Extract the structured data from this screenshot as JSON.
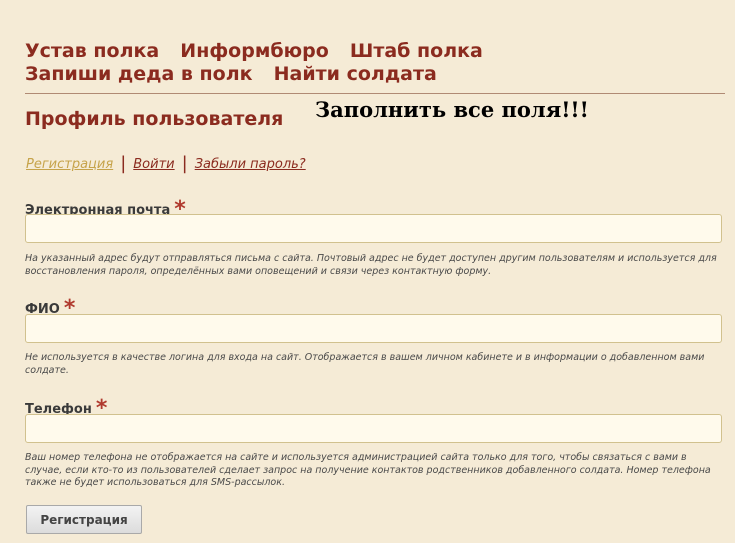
{
  "nav": {
    "items": [
      {
        "label": "Устав полка"
      },
      {
        "label": "Информбюро"
      },
      {
        "label": "Штаб полка"
      },
      {
        "label": "Запиши деда в полк"
      },
      {
        "label": "Найти солдата"
      }
    ]
  },
  "page": {
    "title": "Профиль пользователя",
    "notice": "Заполнить все поля!!!"
  },
  "tabs": {
    "register": "Регистрация",
    "login": "Войти",
    "forgot": "Забыли пароль?",
    "separator": "|"
  },
  "form": {
    "required_mark": "*",
    "email": {
      "label": "Электронная почта",
      "value": "",
      "description": "На указанный адрес будут отправляться письма с сайта. Почтовый адрес не будет доступен другим пользователям и используется для восстановления пароля, определённых вами оповещений и связи через контактную форму."
    },
    "fio": {
      "label": "ФИО",
      "value": "",
      "description": "Не используется в качестве логина для входа на сайт. Отображается в вашем личном кабинете и в информации о добавленном вами солдате."
    },
    "phone": {
      "label": "Телефон",
      "value": "",
      "description": "Ваш номер телефона не отображается на сайте и используется администрацией сайта только для того, чтобы связаться с вами в случае, если кто-то из пользователей сделает запрос на получение контактов родственников добавленного солдата. Номер телефона также не будет использоваться для SMS-рассылок."
    },
    "submit_label": "Регистрация"
  }
}
